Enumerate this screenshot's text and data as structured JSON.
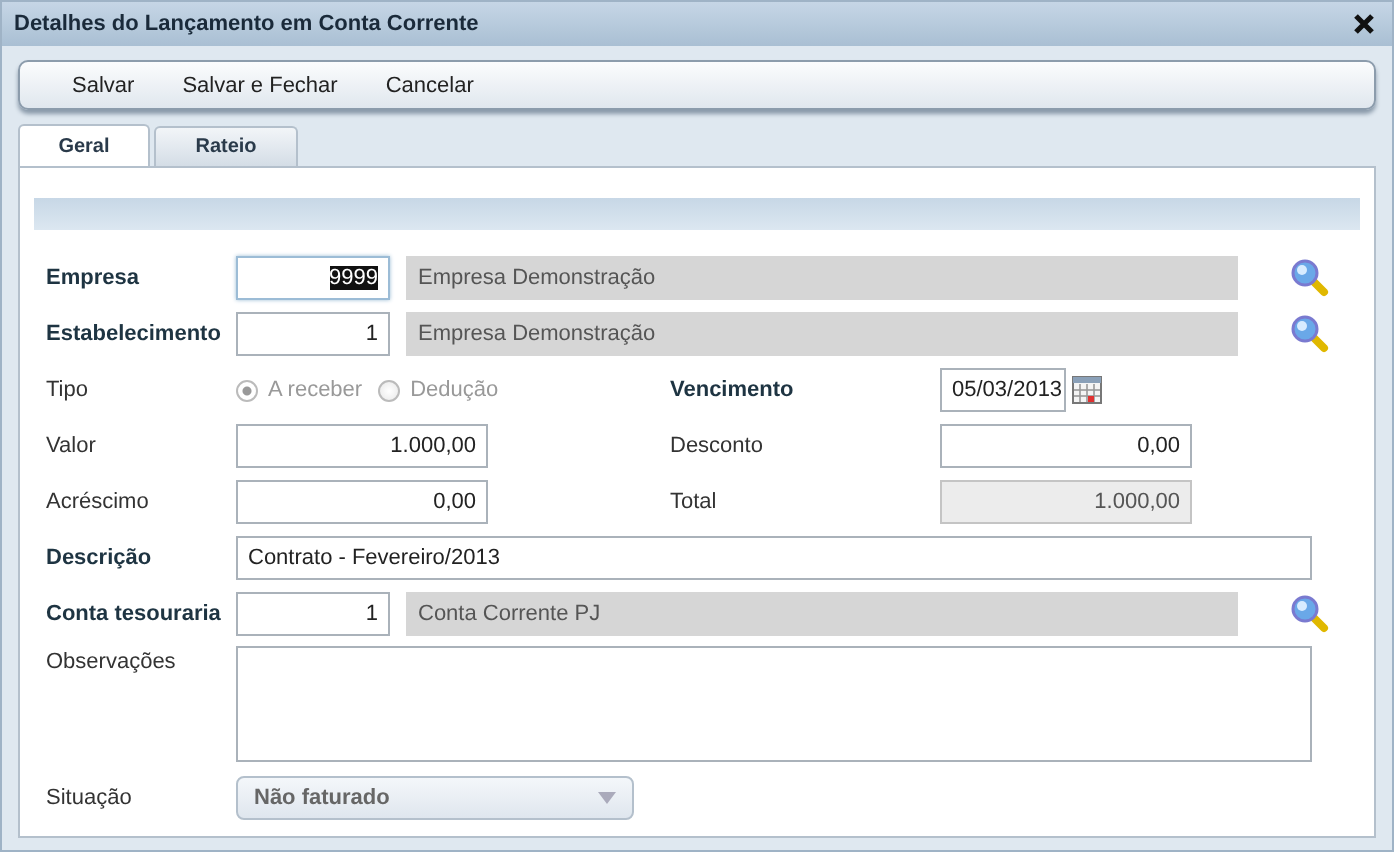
{
  "window": {
    "title": "Detalhes do Lançamento em Conta Corrente"
  },
  "toolbar": [
    "Salvar",
    "Salvar e Fechar",
    "Cancelar"
  ],
  "tabs": [
    {
      "label": "Geral",
      "selected": true
    },
    {
      "label": "Rateio",
      "selected": false
    }
  ],
  "rows": [
    {
      "kind": "lookup",
      "label": "Empresa",
      "required": true,
      "code": "9999",
      "code_selected": true,
      "name": "Empresa Demonstração"
    },
    {
      "kind": "lookup",
      "label": "Estabelecimento",
      "required": true,
      "code": "1",
      "code_selected": false,
      "name": "Empresa Demonstração"
    },
    {
      "kind": "split",
      "left": {
        "kind": "radio",
        "label": "Tipo",
        "required": false,
        "disabled": true,
        "options": [
          {
            "label": "A receber",
            "selected": true
          },
          {
            "label": "Dedução",
            "selected": false
          }
        ]
      },
      "right": {
        "kind": "date",
        "label": "Vencimento",
        "required": true,
        "value": "05/03/2013"
      }
    },
    {
      "kind": "split",
      "left": {
        "kind": "number",
        "label": "Valor",
        "required": false,
        "value": "1.000,00",
        "readonly": false
      },
      "right": {
        "kind": "number",
        "label": "Desconto",
        "required": false,
        "value": "0,00",
        "readonly": false
      }
    },
    {
      "kind": "split",
      "left": {
        "kind": "number",
        "label": "Acréscimo",
        "required": false,
        "value": "0,00",
        "readonly": false
      },
      "right": {
        "kind": "number",
        "label": "Total",
        "required": false,
        "value": "1.000,00",
        "readonly": true
      }
    },
    {
      "kind": "text",
      "label": "Descrição",
      "required": true,
      "value": "Contrato - Fevereiro/2013"
    },
    {
      "kind": "lookup",
      "label": "Conta tesouraria",
      "required": true,
      "code": "1",
      "code_selected": false,
      "name": "Conta Corrente PJ"
    },
    {
      "kind": "textarea",
      "label": "Observações",
      "required": false
    },
    {
      "kind": "select",
      "label": "Situação",
      "required": false,
      "value": "Não faturado"
    }
  ]
}
